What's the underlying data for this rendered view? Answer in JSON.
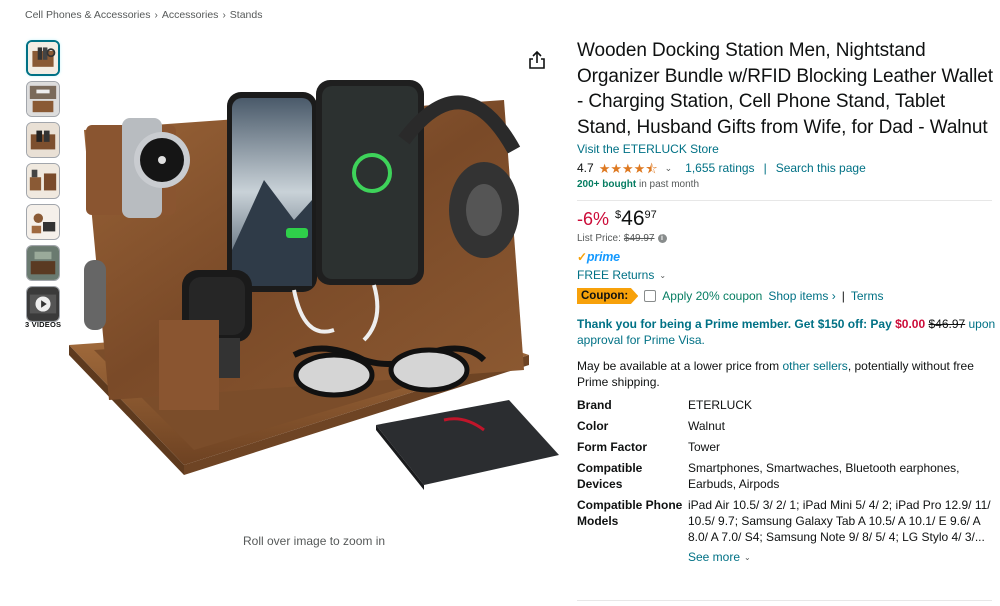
{
  "breadcrumb": {
    "items": [
      "Cell Phones & Accessories",
      "Accessories",
      "Stands"
    ],
    "separator": "›"
  },
  "gallery": {
    "thumbnail_count": 7,
    "active_index": 0,
    "videos_label": "3 VIDEOS",
    "zoom_hint": "Roll over image to zoom in"
  },
  "product": {
    "title": "Wooden Docking Station Men, Nightstand Organizer Bundle w/RFID Blocking Leather Wallet - Charging Station, Cell Phone Stand, Tablet Stand, Husband Gifts from Wife, for Dad - Walnut",
    "store_link": "Visit the ETERLUCK Store",
    "rating": "4.7",
    "rating_stars": 4.7,
    "ratings_count": "1,655 ratings",
    "search_page": "Search this page",
    "bought_bold": "200+ bought",
    "bought_rest": " in past month"
  },
  "price": {
    "discount": "-6%",
    "symbol": "$",
    "whole": "46",
    "fraction": "97",
    "list_label": "List Price:",
    "list_value": "$49.97"
  },
  "shipping": {
    "prime": "prime",
    "free_returns": "FREE Returns"
  },
  "coupon": {
    "badge": "Coupon:",
    "apply": "Apply 20% coupon",
    "shop_items": "Shop items ›",
    "separator": "|",
    "terms": "Terms"
  },
  "prime_offer": {
    "bold": "Thank you for being a Prime member. Get $150 off: Pay ",
    "pay_price": "$0.00",
    "old_price": "$46.97",
    "upon": " upon",
    "approval": "approval for Prime Visa."
  },
  "lower_price": {
    "before": "May be available at a lower price from ",
    "link": "other sellers",
    "after": ", potentially without free Prime shipping."
  },
  "specs": [
    {
      "key": "Brand",
      "value": "ETERLUCK"
    },
    {
      "key": "Color",
      "value": "Walnut"
    },
    {
      "key": "Form Factor",
      "value": "Tower"
    },
    {
      "key": "Compatible Devices",
      "value": "Smartphones, Smartwaches, Bluetooth earphones, Earbuds, Airpods"
    },
    {
      "key": "Compatible Phone Models",
      "value": "iPad Air 10.5/ 3/ 2/ 1; iPad Mini 5/ 4/ 2; iPad Pro 12.9/ 11/ 10.5/ 9.7; Samsung Galaxy Tab A 10.5/ A 10.1/ E 9.6/ A 8.0/ A 7.0/ S4; Samsung Note 9/ 8/ 5/ 4; LG Stylo 4/ 3/..."
    }
  ],
  "see_more": "See more",
  "colors": {
    "link": "#007185",
    "discount": "#cc0c39",
    "star": "#de7921",
    "coupon": "#f7a10a",
    "prime_blue": "#1399ff",
    "green": "#067d62"
  }
}
